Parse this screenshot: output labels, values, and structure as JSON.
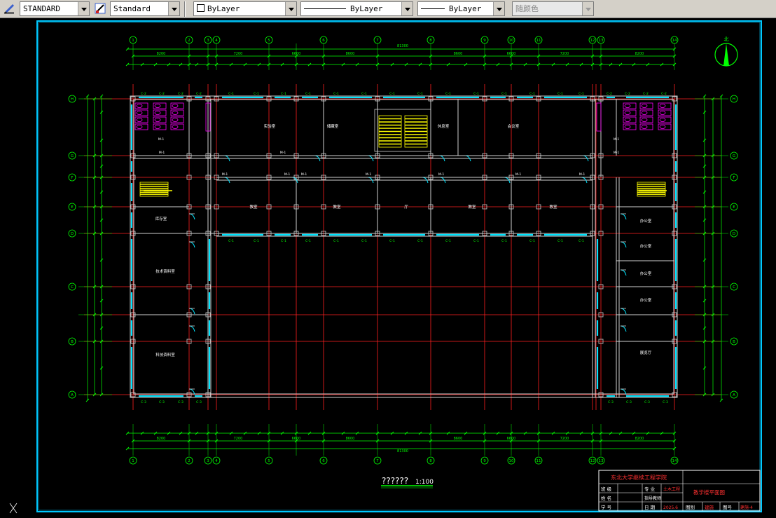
{
  "toolbar": {
    "text_style": "STANDARD",
    "dim_style": "Standard",
    "layer": "ByLayer",
    "linetype": "ByLayer",
    "lineweight": "ByLayer",
    "color": "随颜色"
  },
  "colors": {
    "background": "#000000",
    "axis": "#ff2020",
    "wall": "#d0d0d0",
    "window": "#00e5ff",
    "dimension": "#00ff00",
    "fixture": "#ff00ff",
    "stair": "#ffff00",
    "frame": "#00c8ff",
    "title_red": "#ff3030"
  },
  "drawing": {
    "title_bar": "??????",
    "scale": "1:100",
    "top_axes": [
      "1",
      "2",
      "3",
      "4",
      "5",
      "6",
      "7",
      "8",
      "9",
      "10",
      "11",
      "12",
      "13",
      "14"
    ],
    "bottom_axes": [
      "1",
      "2",
      "3",
      "4",
      "5",
      "6",
      "7",
      "8",
      "9",
      "10",
      "11",
      "12",
      "13",
      "14"
    ],
    "left_axes": [
      "H",
      "G",
      "F",
      "E",
      "D",
      "C",
      "B",
      "A"
    ],
    "right_axes": [
      "H",
      "G",
      "F",
      "E",
      "D",
      "C",
      "B",
      "A"
    ],
    "total_dimension": "81300",
    "top_dims": [
      "8200",
      "7200",
      "6600",
      "8600",
      "8600",
      "6600",
      "7200",
      "8200"
    ],
    "window_tags": [
      "C-1",
      "C-2",
      "C-3"
    ],
    "door_tags": [
      "M-1",
      "M-2",
      "M-3"
    ],
    "rooms": [
      "实验室",
      "储藏室",
      "休息室",
      "会议室",
      "教室",
      "教室",
      "厅",
      "教室",
      "教室",
      "库存室",
      "办公室",
      "办公室",
      "办公室",
      "办公室",
      "技术资料室",
      "展览厅",
      "科技资料室"
    ]
  },
  "title_block": {
    "school": "东北大学继续工程学院",
    "row1": [
      "班 级",
      "专 业"
    ],
    "row2": [
      "姓 名",
      "指导教师"
    ],
    "row3": [
      "学 号",
      "日 期",
      "图别",
      "图号"
    ],
    "sheet_name": "教学楼平面图",
    "values": [
      "土木工程",
      "2025.6",
      "建施",
      "建施-4"
    ]
  }
}
